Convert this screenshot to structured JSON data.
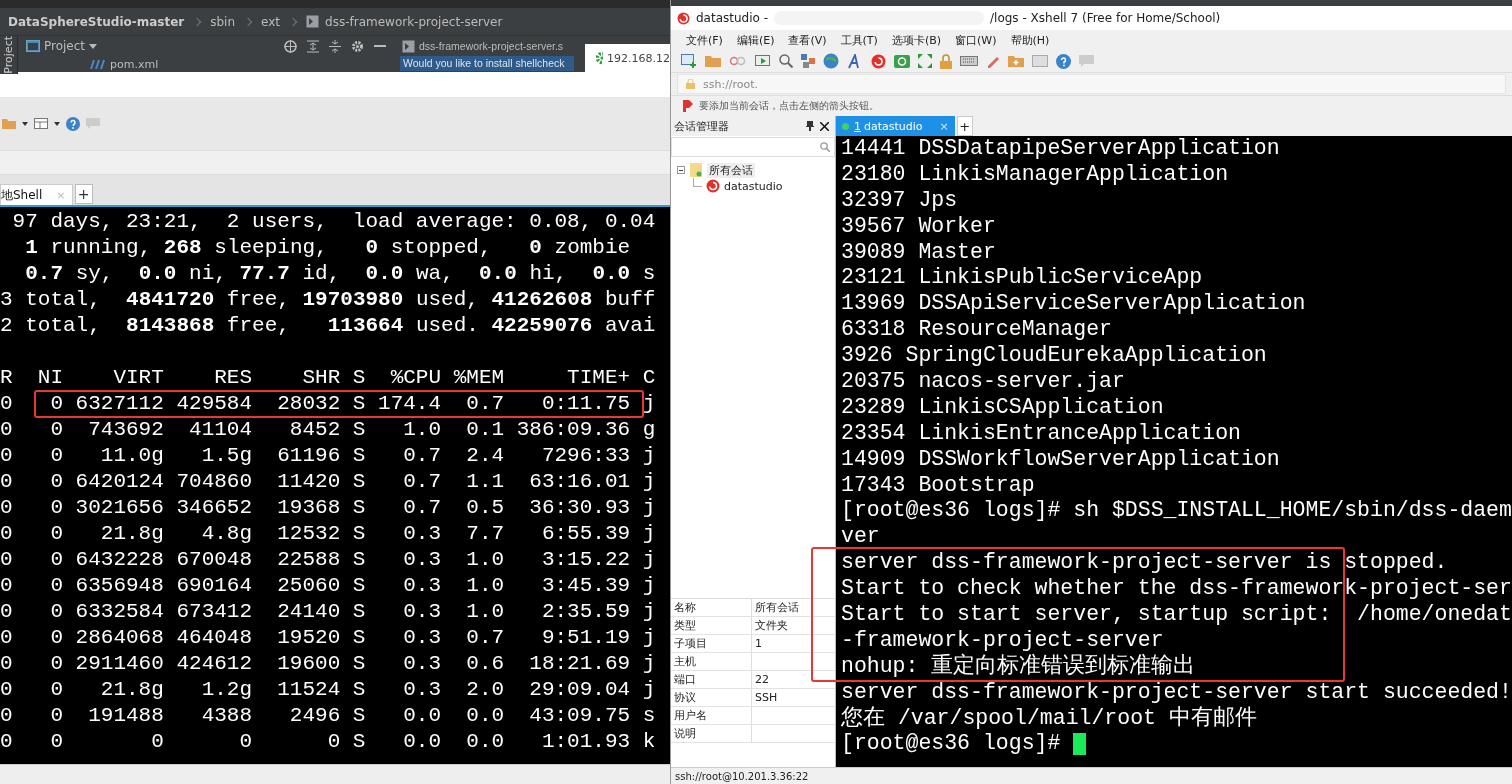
{
  "ide": {
    "breadcrumb": [
      "DataSphereStudio-master",
      "sbin",
      "ext",
      "dss-framework-project-server"
    ],
    "side_label": "Project",
    "project_view": "Project",
    "tree_item": "pom.xml",
    "editor_tab": "dss-framework-project-server.s",
    "notification": "Would you like to install shellcheck",
    "popup_host": "192.168.12"
  },
  "local_shell": {
    "tabs": [
      {
        "label": "地Shell",
        "close": "×",
        "selected": true
      }
    ],
    "add_tab": "+",
    "lines": [
      {
        "text": " 97 days, 23:21,  2 users,  load average: 0.08, 0.04",
        "highlighted": false
      },
      {
        "text": "  **1** running, **268** sleeping,   **0** stopped,   **0** zombie",
        "highlighted": false
      },
      {
        "text": "  **0.7** sy,  **0.0** ni, **77.7** id,  **0.0** wa,  **0.0** hi,  **0.0** s",
        "highlighted": false
      },
      {
        "text": "3 total,  **4841720** free, **19703980** used, **41262608** buff",
        "highlighted": false
      },
      {
        "text": "2 total,  **8143868** free,   **113664** used. **42259076** avai",
        "highlighted": false
      },
      {
        "highlighted": false
      },
      {
        "text": "R  NI    VIRT    RES    SHR S  %CPU %MEM     TIME+ C",
        "highlighted": false
      },
      {
        "text": "0   0 6327112 429584  28032 S 174.4  0.7   0:11.75 j",
        "highlighted": true
      },
      {
        "text": "0   0  743692  41104   8452 S   1.0  0.1 386:09.36 g",
        "highlighted": false
      },
      {
        "text": "0   0   11.0g   1.5g  61196 S   0.7  2.4   7296:33 j",
        "highlighted": false
      },
      {
        "text": "0   0 6420124 704860  11420 S   0.7  1.1  63:16.01 j",
        "highlighted": false
      },
      {
        "text": "0   0 3021656 346652  19368 S   0.7  0.5  36:30.93 j",
        "highlighted": false
      },
      {
        "text": "0   0   21.8g   4.8g  12532 S   0.3  7.7   6:55.39 j",
        "highlighted": false
      },
      {
        "text": "0   0 6432228 670048  22588 S   0.3  1.0   3:15.22 j",
        "highlighted": false
      },
      {
        "text": "0   0 6356948 690164  25060 S   0.3  1.0   3:45.39 j",
        "highlighted": false
      },
      {
        "text": "0   0 6332584 673412  24140 S   0.3  1.0   2:35.59 j",
        "highlighted": false
      },
      {
        "text": "0   0 2864068 464048  19520 S   0.3  0.7   9:51.19 j",
        "highlighted": false
      },
      {
        "text": "0   0 2911460 424612  19600 S   0.3  0.6  18:21.69 j",
        "highlighted": false
      },
      {
        "text": "0   0   21.8g   1.2g  11524 S   0.3  2.0  29:09.04 j",
        "highlighted": false
      },
      {
        "text": "0   0  191488   4388   2496 S   0.0  0.0  43:09.75 s",
        "highlighted": false
      },
      {
        "text": "0   0       0      0      0 S   0.0  0.0   1:01.93 k",
        "highlighted": false
      }
    ]
  },
  "xshell": {
    "title": [
      "datastudio -",
      "/logs - Xshell 7 (Free for Home/School)"
    ],
    "menu": [
      "文件(F)",
      "编辑(E)",
      "查看(V)",
      "工具(T)",
      "选项卡(B)",
      "窗口(W)",
      "帮助(H)"
    ],
    "address": "ssh://root.",
    "hint": "要添加当前会话，点击左侧的箭头按钮。",
    "sidebar": {
      "title": "会话管理器",
      "tree": [
        {
          "label": "所有会话",
          "expanded": true,
          "children": [
            {
              "label": "datastudio"
            }
          ]
        }
      ],
      "properties": [
        {
          "name": "名称",
          "value": "所有会话"
        },
        {
          "name": "类型",
          "value": "文件夹"
        },
        {
          "name": "子项目",
          "value": "1"
        },
        {
          "name": "主机"
        },
        {
          "name": "端口",
          "value": "22"
        },
        {
          "name": "协议",
          "value": "SSH"
        },
        {
          "name": "用户名"
        },
        {
          "name": "说明"
        }
      ]
    },
    "tabs": [
      {
        "number": "1",
        "label": "datastudio",
        "close": "×",
        "selected": true
      }
    ],
    "add_tab": "+",
    "terminal": {
      "cursor": true,
      "lines": [
        {
          "text": "14441 DSSDatapipeServerApplication",
          "highlighted": false
        },
        {
          "text": "23180 LinkisManagerApplication",
          "highlighted": false
        },
        {
          "text": "32397 Jps",
          "highlighted": false
        },
        {
          "text": "39567 Worker",
          "highlighted": false
        },
        {
          "text": "39089 Master",
          "highlighted": false
        },
        {
          "text": "23121 LinkisPublicServiceApp",
          "highlighted": false
        },
        {
          "text": "13969 DSSApiServiceServerApplication",
          "highlighted": false
        },
        {
          "text": "63318 ResourceManager",
          "highlighted": false
        },
        {
          "text": "3926 SpringCloudEurekaApplication",
          "highlighted": false
        },
        {
          "text": "20375 nacos-server.jar",
          "highlighted": false
        },
        {
          "text": "23289 LinkisCSApplication",
          "highlighted": false
        },
        {
          "text": "23354 LinkisEntranceApplication",
          "highlighted": false
        },
        {
          "text": "14909 DSSWorkflowServerApplication",
          "highlighted": false
        },
        {
          "text": "17343 Bootstrap",
          "highlighted": false
        },
        {
          "text": "[root@es36 logs]# sh $DSS_INSTALL_HOME/sbin/dss-daem",
          "highlighted": false
        },
        {
          "text": "ver",
          "highlighted": false
        },
        {
          "text": "server dss-framework-project-server is stopped.",
          "highlighted": true
        },
        {
          "text": "Start to check whether the dss-framework-project-ser",
          "highlighted": true
        },
        {
          "text": "Start to start server, startup script:  /home/onedat",
          "highlighted": true
        },
        {
          "text": "-framework-project-server",
          "highlighted": true
        },
        {
          "text": "nohup: 重定向标准错误到标准输出",
          "highlighted": true
        },
        {
          "text": "server dss-framework-project-server start succeeded!",
          "highlighted": false
        },
        {
          "text": "您在 /var/spool/mail/root 中有邮件",
          "highlighted": false
        },
        {
          "text": "[root@es36 logs]# ",
          "highlighted": false
        }
      ]
    },
    "status": "ssh://root@10.201.3.36:22"
  }
}
